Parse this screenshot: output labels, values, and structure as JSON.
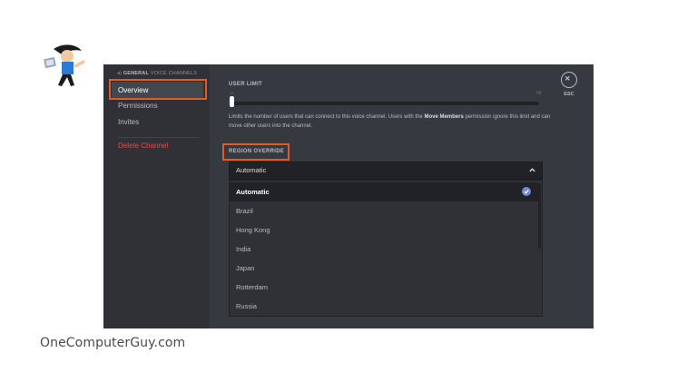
{
  "sidebar": {
    "channel_name": "GENERAL",
    "section": "VOICE CHANNELS",
    "items": [
      {
        "label": "Overview"
      },
      {
        "label": "Permissions"
      },
      {
        "label": "Invites"
      }
    ],
    "delete_label": "Delete Channel"
  },
  "main": {
    "user_limit": {
      "label": "USER LIMIT",
      "min_mark": "∞",
      "max_mark": "99",
      "value_fraction": 0,
      "desc_before": "Limits the number of users that can connect to this voice channel. Users with the ",
      "desc_bold": "Move Members",
      "desc_after": " permission ignore this limit and can move other users into the channel."
    },
    "region": {
      "label": "REGION OVERRIDE",
      "selected": "Automatic",
      "options": [
        "Automatic",
        "Brazil",
        "Hong Kong",
        "India",
        "Japan",
        "Rotterdam",
        "Russia"
      ]
    },
    "close_label": "ESC"
  },
  "watermark": "OneComputerGuy.com",
  "colors": {
    "accent": "#7289da",
    "danger": "#f04747",
    "highlight": "#e05a2b",
    "background": "#36393f",
    "sidebar": "#2f3136"
  }
}
